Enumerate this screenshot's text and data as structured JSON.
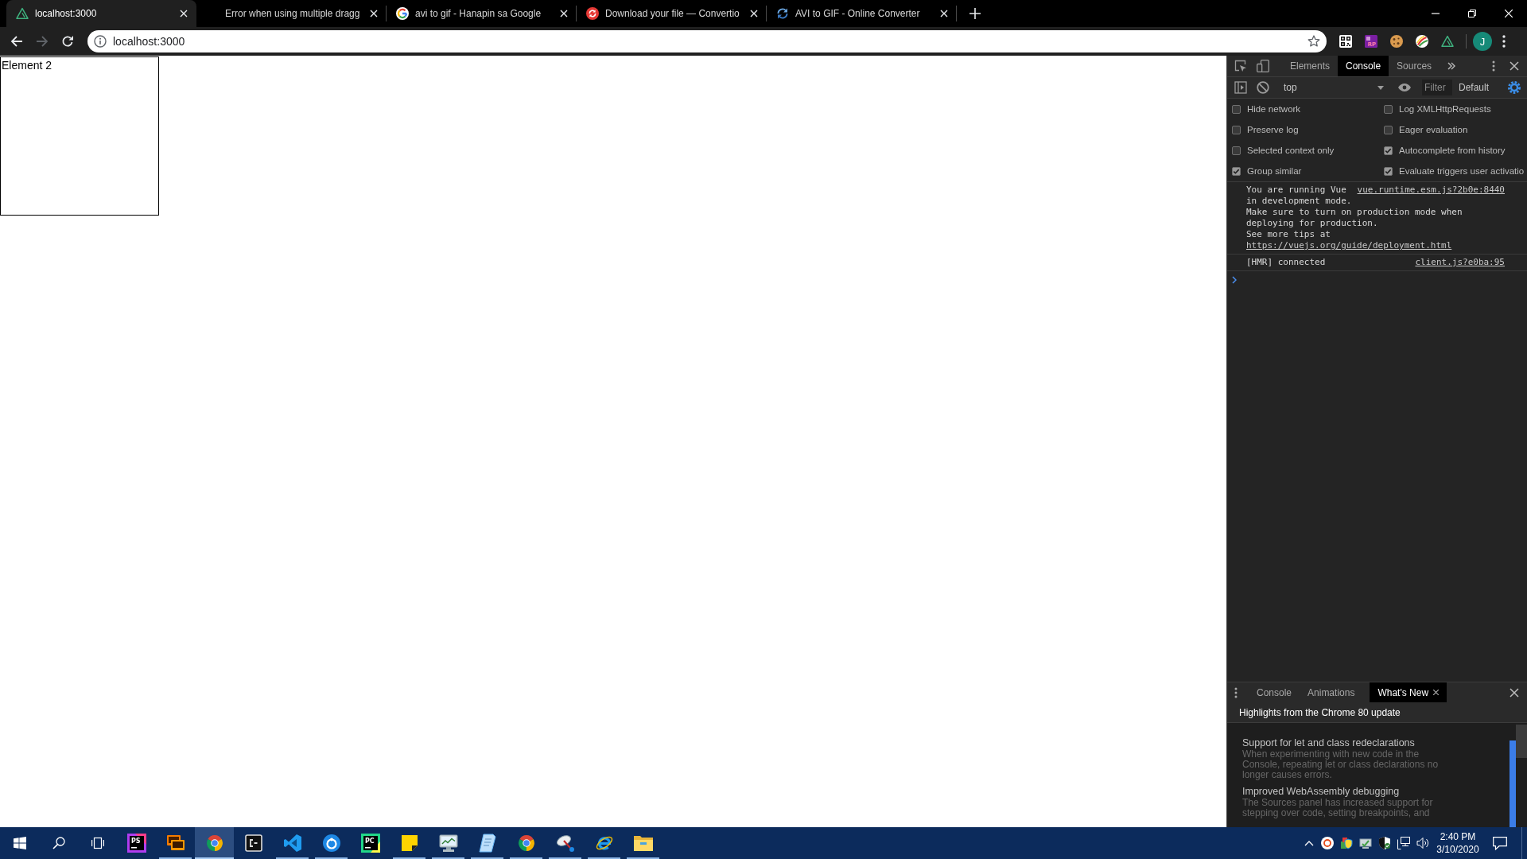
{
  "browser": {
    "tabs": [
      {
        "title": "localhost:3000",
        "kind": "triangle",
        "selected": true
      },
      {
        "title": "Error when using multiple dragg",
        "kind": "blank",
        "selected": false
      },
      {
        "title": "avi to gif - Hanapin sa Google",
        "kind": "google",
        "selected": false
      },
      {
        "title": "Download your file — Convertio",
        "kind": "convertio",
        "selected": false
      },
      {
        "title": "AVI to GIF - Online Converter",
        "kind": "arrows",
        "selected": false
      }
    ],
    "nav_buttons": [
      {
        "kind": "back",
        "disabled": false
      },
      {
        "kind": "forward",
        "disabled": true
      },
      {
        "kind": "reload",
        "disabled": false
      }
    ],
    "address": {
      "value": "localhost:3000"
    },
    "extensions": [
      {
        "kind": "qr"
      },
      {
        "kind": "rp",
        "label": "RP"
      },
      {
        "kind": "cookie"
      },
      {
        "kind": "swirl"
      },
      {
        "kind": "triangle"
      }
    ],
    "profile": {
      "initial": "J"
    }
  },
  "page": {
    "element_label": "Element 2"
  },
  "devtools": {
    "tabs": [
      {
        "label": "Elements",
        "selected": false
      },
      {
        "label": "Console",
        "selected": true
      },
      {
        "label": "Sources",
        "selected": false
      }
    ],
    "context": "top",
    "filter": {
      "placeholder": "Filter"
    },
    "levels": "Default",
    "settings": [
      {
        "label": "Hide network",
        "checked": false
      },
      {
        "label": "Log XMLHttpRequests",
        "checked": false
      },
      {
        "label": "Preserve log",
        "checked": false
      },
      {
        "label": "Eager evaluation",
        "checked": false
      },
      {
        "label": "Selected context only",
        "checked": false
      },
      {
        "label": "Autocomplete from history",
        "checked": true
      },
      {
        "label": "Group similar",
        "checked": true
      },
      {
        "label": "Evaluate triggers user activatio",
        "checked": true
      }
    ],
    "messages": [
      {
        "source": "vue.runtime.esm.js?2b0e:8440",
        "lines": [
          {
            "text": "You are running Vue in development mode."
          },
          {
            "text": "Make sure to turn on production mode when deploying for production."
          },
          {
            "text": "See more tips at",
            "link": "https://vuejs.org/guide/deployment.html"
          }
        ]
      },
      {
        "source": "client.js?e0ba:95",
        "lines": [
          {
            "text": "[HMR] connected"
          }
        ]
      }
    ],
    "drawer": {
      "tabs": [
        {
          "label": "Console",
          "selected": false,
          "closable": false
        },
        {
          "label": "Animations",
          "selected": false,
          "closable": false
        },
        {
          "label": "What's New",
          "selected": true,
          "closable": true
        }
      ],
      "heading": "Highlights from the Chrome 80 update",
      "items": [
        {
          "title": "Support for let and class redeclarations",
          "description": "When experimenting with new code in the Console, repeating let or class declarations no longer causes errors."
        },
        {
          "title": "Improved WebAssembly debugging",
          "description": "The Sources panel has increased support for stepping over code, setting breakpoints, and"
        }
      ]
    }
  },
  "taskbar": {
    "apps": [
      {
        "kind": "ps",
        "label": "PS",
        "running": false,
        "selected": false
      },
      {
        "kind": "recorder",
        "running": true,
        "selected": false
      },
      {
        "kind": "chrome",
        "running": true,
        "selected": true
      },
      {
        "kind": "console",
        "running": false,
        "selected": false
      },
      {
        "kind": "vscode",
        "running": true,
        "selected": false
      },
      {
        "kind": "ring",
        "running": true,
        "selected": false
      },
      {
        "kind": "pc",
        "label": "PC",
        "running": false,
        "selected": false
      },
      {
        "kind": "sticky",
        "running": true,
        "selected": false
      },
      {
        "kind": "monitor",
        "running": true,
        "selected": false
      },
      {
        "kind": "notepad",
        "running": true,
        "selected": false
      },
      {
        "kind": "chrome",
        "running": true,
        "selected": false
      },
      {
        "kind": "dish",
        "running": true,
        "selected": false
      },
      {
        "kind": "ie",
        "running": true,
        "selected": false
      },
      {
        "kind": "folder",
        "running": true,
        "selected": false
      }
    ],
    "clock": {
      "time": "2:40 PM",
      "date": "3/10/2020"
    }
  }
}
